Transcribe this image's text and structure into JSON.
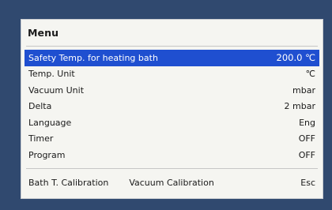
{
  "menu": {
    "title": "Menu",
    "items": [
      {
        "label": "Safety Temp. for heating bath",
        "value": "200.0 ℃",
        "selected": true
      },
      {
        "label": "Temp. Unit",
        "value": "℃",
        "selected": false
      },
      {
        "label": "Vacuum Unit",
        "value": "mbar",
        "selected": false
      },
      {
        "label": "Delta",
        "value": "2 mbar",
        "selected": false
      },
      {
        "label": "Language",
        "value": "Eng",
        "selected": false
      },
      {
        "label": "Timer",
        "value": "OFF",
        "selected": false
      },
      {
        "label": "Program",
        "value": "OFF",
        "selected": false
      }
    ]
  },
  "softkeys": {
    "bath_calibration": "Bath T. Calibration",
    "vacuum_calibration": "Vacuum Calibration",
    "escape": "Esc"
  },
  "colors": {
    "bezel": "#30496f",
    "screen": "#f5f5f1",
    "selection": "#1f4fd0",
    "text": "#1a1a1a"
  }
}
